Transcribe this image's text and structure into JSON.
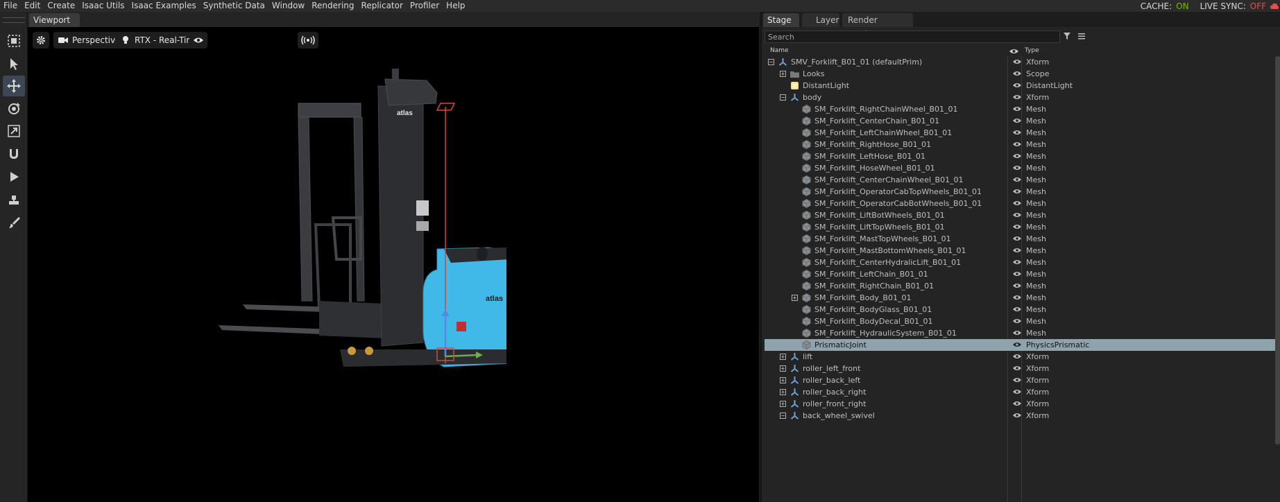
{
  "menu": [
    "File",
    "Edit",
    "Create",
    "Isaac Utils",
    "Isaac Examples",
    "Synthetic Data",
    "Window",
    "Rendering",
    "Replicator",
    "Profiler",
    "Help"
  ],
  "status": {
    "cache_label": "CACHE:",
    "cache_value": "ON",
    "live_sync_label": "LIVE SYNC:",
    "live_sync_value": "OFF"
  },
  "viewport": {
    "tab": "Viewport",
    "camera_label": "Perspective",
    "renderer_label": "RTX - Real-Time",
    "forklift_brand_mast": "atlas",
    "forklift_brand_body": "atlas"
  },
  "panel": {
    "tabs": [
      "Stage",
      "Layer",
      "Render Settings"
    ],
    "search_placeholder": "Search",
    "col_name": "Name",
    "col_type": "Type",
    "rows": [
      {
        "name": "SMV_Forklift_B01_01 (defaultPrim)",
        "type": "Xform",
        "icon": "xform-icon",
        "exp": "minus"
      },
      {
        "name": "Looks",
        "type": "Scope",
        "icon": "folder-icon",
        "exp": "plus"
      },
      {
        "name": "DistantLight",
        "type": "DistantLight",
        "icon": "light-icon",
        "exp": ""
      },
      {
        "name": "body",
        "type": "Xform",
        "icon": "xform-icon",
        "exp": "minus"
      },
      {
        "name": "SM_Forklift_RightChainWheel_B01_01",
        "type": "Mesh",
        "icon": "mesh-icon",
        "exp": ""
      },
      {
        "name": "SM_Forklift_CenterChain_B01_01",
        "type": "Mesh",
        "icon": "mesh-icon",
        "exp": ""
      },
      {
        "name": "SM_Forklift_LeftChainWheel_B01_01",
        "type": "Mesh",
        "icon": "mesh-icon",
        "exp": ""
      },
      {
        "name": "SM_Forklift_RightHose_B01_01",
        "type": "Mesh",
        "icon": "mesh-icon",
        "exp": ""
      },
      {
        "name": "SM_Forklift_LeftHose_B01_01",
        "type": "Mesh",
        "icon": "mesh-icon",
        "exp": ""
      },
      {
        "name": "SM_Forklift_HoseWheel_B01_01",
        "type": "Mesh",
        "icon": "mesh-icon",
        "exp": ""
      },
      {
        "name": "SM_Forklift_CenterChainWheel_B01_01",
        "type": "Mesh",
        "icon": "mesh-icon",
        "exp": ""
      },
      {
        "name": "SM_Forklift_OperatorCabTopWheels_B01_01",
        "type": "Mesh",
        "icon": "mesh-icon",
        "exp": ""
      },
      {
        "name": "SM_Forklift_OperatorCabBotWheels_B01_01",
        "type": "Mesh",
        "icon": "mesh-icon",
        "exp": ""
      },
      {
        "name": "SM_Forklift_LiftBotWheels_B01_01",
        "type": "Mesh",
        "icon": "mesh-icon",
        "exp": ""
      },
      {
        "name": "SM_Forklift_LiftTopWheels_B01_01",
        "type": "Mesh",
        "icon": "mesh-icon",
        "exp": ""
      },
      {
        "name": "SM_Forklift_MastTopWheels_B01_01",
        "type": "Mesh",
        "icon": "mesh-icon",
        "exp": ""
      },
      {
        "name": "SM_Forklift_MastBottomWheels_B01_01",
        "type": "Mesh",
        "icon": "mesh-icon",
        "exp": ""
      },
      {
        "name": "SM_Forklift_CenterHydralicLift_B01_01",
        "type": "Mesh",
        "icon": "mesh-icon",
        "exp": ""
      },
      {
        "name": "SM_Forklift_LeftChain_B01_01",
        "type": "Mesh",
        "icon": "mesh-icon",
        "exp": ""
      },
      {
        "name": "SM_Forklift_RightChain_B01_01",
        "type": "Mesh",
        "icon": "mesh-icon",
        "exp": ""
      },
      {
        "name": "SM_Forklift_Body_B01_01",
        "type": "Mesh",
        "icon": "mesh-icon",
        "exp": "plus"
      },
      {
        "name": "SM_Forklift_BodyGlass_B01_01",
        "type": "Mesh",
        "icon": "mesh-icon",
        "exp": ""
      },
      {
        "name": "SM_Forklift_BodyDecal_B01_01",
        "type": "Mesh",
        "icon": "mesh-icon",
        "exp": ""
      },
      {
        "name": "SM_Forklift_HydraulicSystem_B01_01",
        "type": "Mesh",
        "icon": "mesh-icon",
        "exp": ""
      },
      {
        "name": "PrismaticJoint",
        "type": "PhysicsPrismatic",
        "icon": "mesh-icon",
        "exp": "",
        "selected": true
      },
      {
        "name": "lift",
        "type": "Xform",
        "icon": "xform-icon",
        "exp": "plus"
      },
      {
        "name": "roller_left_front",
        "type": "Xform",
        "icon": "xform-icon",
        "exp": "plus"
      },
      {
        "name": "roller_back_left",
        "type": "Xform",
        "icon": "xform-icon",
        "exp": "plus"
      },
      {
        "name": "roller_back_right",
        "type": "Xform",
        "icon": "xform-icon",
        "exp": "plus"
      },
      {
        "name": "roller_front_right",
        "type": "Xform",
        "icon": "xform-icon",
        "exp": "plus"
      },
      {
        "name": "back_wheel_swivel",
        "type": "Xform",
        "icon": "xform-icon",
        "exp": "minus"
      }
    ]
  }
}
